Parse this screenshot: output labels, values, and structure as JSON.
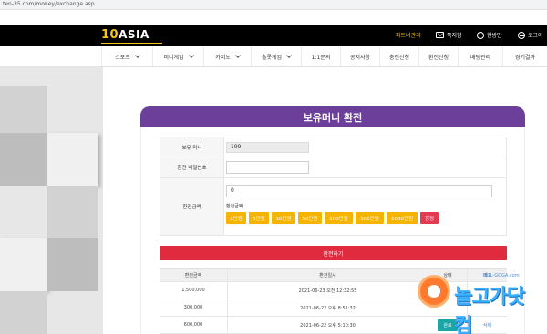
{
  "browser": {
    "url": "ten-35.com/money/exchange.asp"
  },
  "brand": {
    "logo_number": "10",
    "logo_word": "ASIA"
  },
  "top_links": {
    "partner": "파트너관리",
    "message": "쪽지함",
    "user": "한방만",
    "login": "로그아"
  },
  "nav": {
    "items": [
      {
        "label": "스포츠",
        "has_dropdown": true
      },
      {
        "label": "미니게임",
        "has_dropdown": true
      },
      {
        "label": "카지노",
        "has_dropdown": true
      },
      {
        "label": "슬롯게임",
        "has_dropdown": true
      },
      {
        "label": "1:1문의",
        "has_dropdown": false
      },
      {
        "label": "공지사항",
        "has_dropdown": false
      },
      {
        "label": "충전신청",
        "has_dropdown": false
      },
      {
        "label": "환전신청",
        "has_dropdown": false
      },
      {
        "label": "배팅관리",
        "has_dropdown": false
      },
      {
        "label": "경기결과",
        "has_dropdown": false
      }
    ]
  },
  "panel": {
    "title": "보유머니 환전",
    "money_label": "보유 머니",
    "money_value": "199",
    "password_label": "환전 비밀번호",
    "amount_label": "환전금액",
    "amount_value": "0",
    "amount_caption": "환전금액",
    "amount_buttons": [
      "1만원",
      "5만원",
      "10만원",
      "50만원",
      "100만원",
      "500만원",
      "1000만원"
    ],
    "reset_button": "정정",
    "submit_button": "환전하기"
  },
  "history": {
    "headers": [
      "환전금액",
      "환전일시",
      "상태",
      "비고"
    ],
    "rows": [
      {
        "amount": "1,500,000",
        "datetime": "2021-06-23 오전 12:32:55",
        "status": "",
        "note": ""
      },
      {
        "amount": "300,000",
        "datetime": "2021-06-22 오후 8:51:32",
        "status": "",
        "note": ""
      },
      {
        "amount": "600,000",
        "datetime": "2021-06-22 오후 5:10:30",
        "status": "완료",
        "note": "삭제"
      }
    ]
  },
  "watermark": {
    "url": "NOL-GOGA.com",
    "text": "놀고가닷컴"
  },
  "colors": {
    "topbar": "#000000",
    "logo_accent": "#f5c518",
    "panel_header": "#6b3f9a",
    "amount_button": "#f5b400",
    "reset_button": "#e23b52",
    "submit_button": "#e02b3e",
    "status_button": "#1aa6a6"
  }
}
